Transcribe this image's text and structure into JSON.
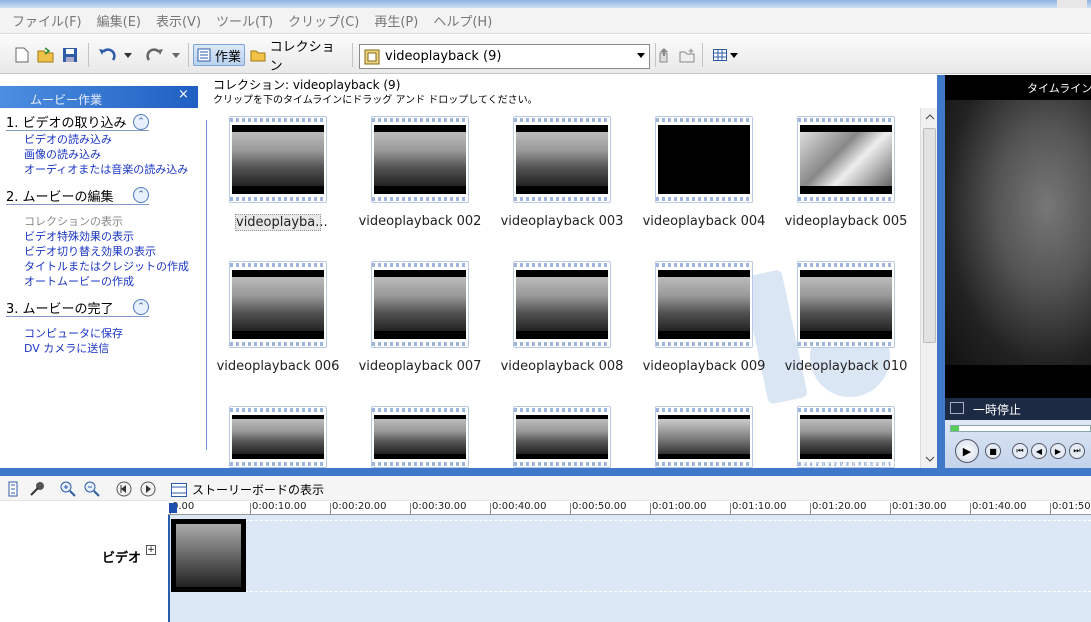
{
  "menu": [
    "ファイル(F)",
    "編集(E)",
    "表示(V)",
    "ツール(T)",
    "クリップ(C)",
    "再生(P)",
    "ヘルプ(H)"
  ],
  "toolbar": {
    "tasks_label": "作業",
    "collections_label": "コレクション",
    "collection_combo": "videoplayback (9)"
  },
  "tasks": {
    "header": "ムービー作業",
    "close": "×",
    "sections": [
      {
        "title": "1. ビデオの取り込み",
        "links": [
          "ビデオの読み込み",
          "画像の読み込み",
          "オーディオまたは音楽の読み込み"
        ]
      },
      {
        "title": "2. ムービーの編集",
        "links": [
          "コレクションの表示",
          "ビデオ特殊効果の表示",
          "ビデオ切り替え効果の表示",
          "タイトルまたはクレジットの作成",
          "オートムービーの作成"
        ]
      },
      {
        "title": "3. ムービーの完了",
        "links": [
          "コンピュータに保存",
          "DV カメラに送信"
        ]
      }
    ]
  },
  "collection": {
    "title": "コレクション: videoplayback (9)",
    "subtitle": "クリップを下のタイムラインにドラッグ アンド ドロップしてください。",
    "clips": [
      {
        "name": "videoplayba...",
        "scene": "group",
        "selected": true
      },
      {
        "name": "videoplayback 002",
        "scene": "group"
      },
      {
        "name": "videoplayback 003",
        "scene": "group"
      },
      {
        "name": "videoplayback 004",
        "scene": "dark"
      },
      {
        "name": "videoplayback 005",
        "scene": "car"
      },
      {
        "name": "videoplayback 006",
        "scene": "group"
      },
      {
        "name": "videoplayback 007",
        "scene": "group"
      },
      {
        "name": "videoplayback 008",
        "scene": "group"
      },
      {
        "name": "videoplayback 009",
        "scene": "group"
      },
      {
        "name": "videoplayback 010",
        "scene": "group"
      },
      {
        "name": "",
        "scene": "group"
      },
      {
        "name": "",
        "scene": "group"
      },
      {
        "name": "",
        "scene": "group"
      },
      {
        "name": "",
        "scene": "gray"
      },
      {
        "name": "",
        "scene": "group"
      }
    ],
    "overlay_text": "http://ryuwamanan.info/"
  },
  "preview": {
    "title": "タイムライン: v",
    "status": "一時停止"
  },
  "timeline": {
    "storyboard_label": "ストーリーボードの表示",
    "ticks": [
      "0.00",
      "0:00:10.00",
      "0:00:20.00",
      "0:00:30.00",
      "0:00:40.00",
      "0:00:50.00",
      "0:01:00.00",
      "0:01:10.00",
      "0:01:20.00",
      "0:01:30.00",
      "0:01:40.00",
      "0:01:50.00"
    ],
    "track_label": "ビデオ",
    "expand": "⊞"
  },
  "colors": {
    "accent": "#3f78c9",
    "link": "#1a35c4",
    "track": "#dce8f6"
  }
}
